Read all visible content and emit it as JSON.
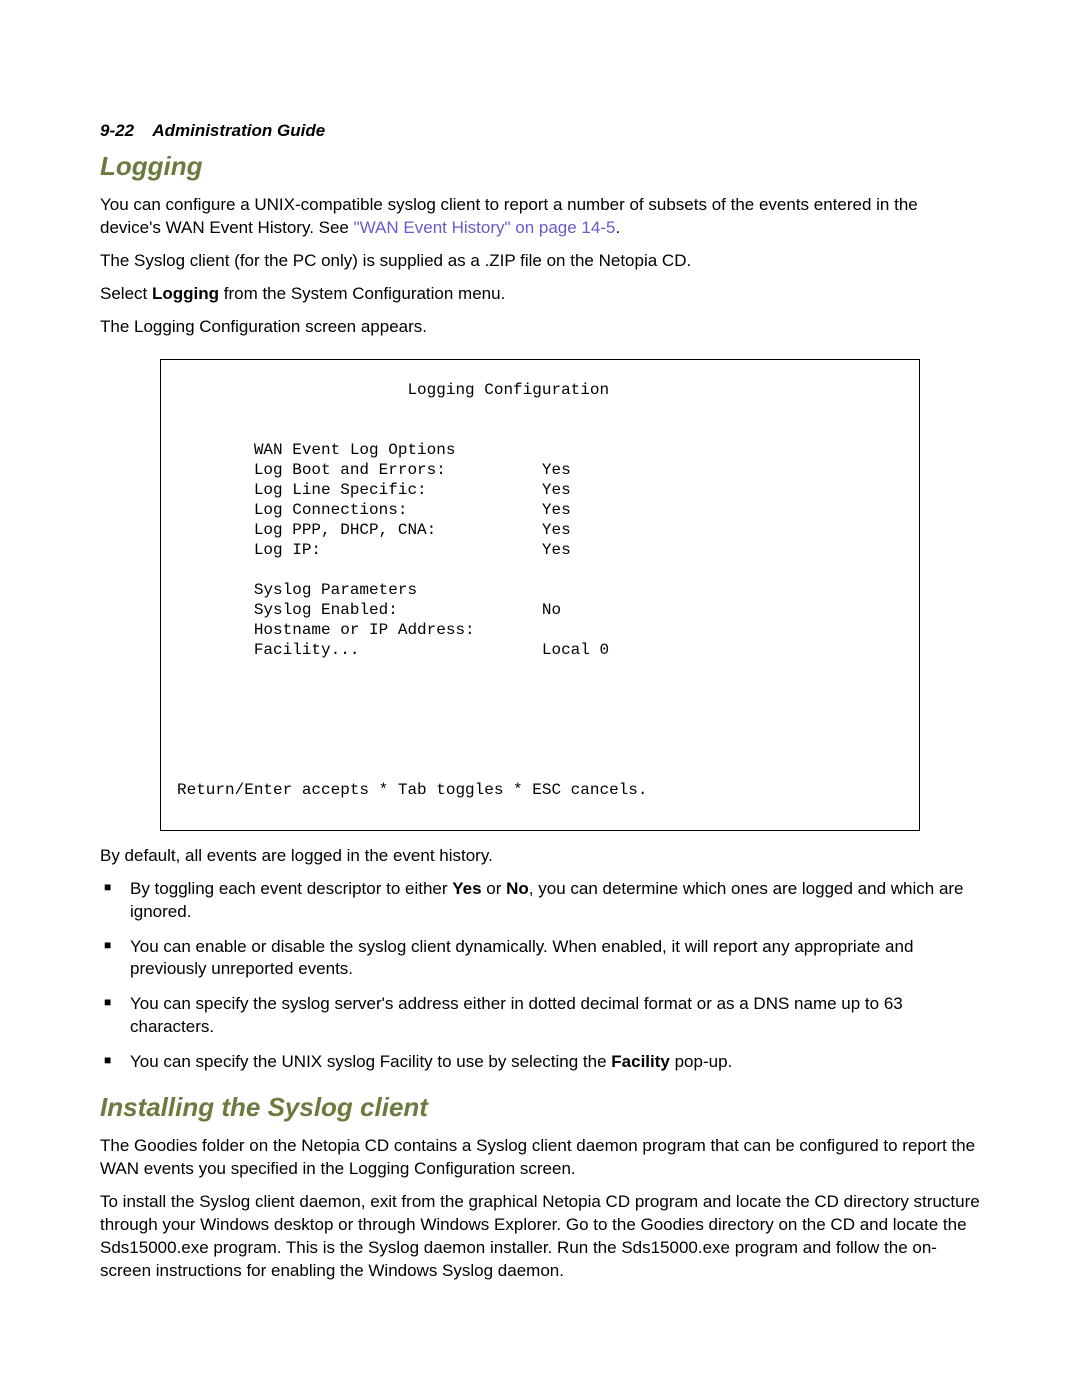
{
  "header": {
    "page_ref": "9-22",
    "doc_title": "Administration Guide"
  },
  "section1": {
    "title": "Logging",
    "para1_a": "You can configure a UNIX-compatible syslog client to report a number of subsets of the events entered in the device's WAN Event History. See ",
    "para1_link": "\"WAN Event History\" on page 14-5",
    "para1_b": ".",
    "para2": "The Syslog client (for the PC only) is supplied as a .ZIP file on the Netopia CD.",
    "para3_a": "Select ",
    "para3_bold": "Logging",
    "para3_b": " from the System Configuration menu.",
    "para4": "The Logging Configuration screen appears."
  },
  "terminal": {
    "title": "Logging Configuration",
    "group1_header": "WAN Event Log Options",
    "rows1": [
      {
        "label": "Log Boot and Errors:",
        "value": "Yes"
      },
      {
        "label": "Log Line Specific:",
        "value": "Yes"
      },
      {
        "label": "Log Connections:",
        "value": "Yes"
      },
      {
        "label": "Log PPP, DHCP, CNA:",
        "value": "Yes"
      },
      {
        "label": "Log IP:",
        "value": "Yes"
      }
    ],
    "group2_header": "Syslog Parameters",
    "rows2": [
      {
        "label": "Syslog Enabled:",
        "value": "No"
      },
      {
        "label": "Hostname or IP Address:",
        "value": ""
      },
      {
        "label": "Facility...",
        "value": "Local 0"
      }
    ],
    "footer": "Return/Enter accepts * Tab toggles * ESC cancels."
  },
  "after_terminal": {
    "lead": "By default, all events are logged in the event history.",
    "bullets": [
      {
        "pre": "By toggling each event descriptor to either ",
        "b1": "Yes",
        "mid": " or ",
        "b2": "No",
        "post": ", you can determine which ones are logged and which are ignored."
      },
      {
        "pre": "You can enable or disable the syslog client dynamically. When enabled, it will report any appropriate and previously unreported events.",
        "b1": "",
        "mid": "",
        "b2": "",
        "post": ""
      },
      {
        "pre": "You can specify the syslog server's address either in dotted decimal format or as a DNS name up to 63 characters.",
        "b1": "",
        "mid": "",
        "b2": "",
        "post": ""
      },
      {
        "pre": "You can specify the UNIX syslog Facility to use by selecting the ",
        "b1": "Facility",
        "mid": "",
        "b2": "",
        "post": " pop-up."
      }
    ]
  },
  "section2": {
    "title": "Installing the Syslog client",
    "para1": "The Goodies folder on the Netopia CD contains a Syslog client daemon program that can be configured to report the WAN events you specified in the Logging Configuration screen.",
    "para2": "To install the Syslog client daemon, exit from the graphical Netopia CD program and locate the CD directory structure through your Windows desktop or through Windows Explorer. Go to the Goodies directory on the CD and locate the Sds15000.exe program. This is the Syslog daemon installer. Run the Sds15000.exe program and follow the on-screen instructions for enabling the Windows Syslog daemon."
  }
}
